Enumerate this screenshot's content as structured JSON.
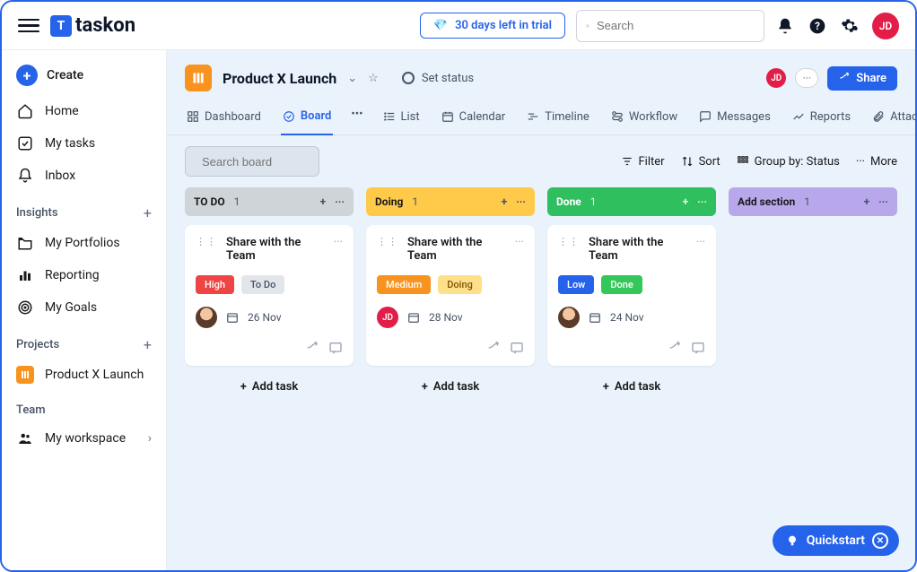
{
  "brand": "taskon",
  "trial_label": "30 days left in trial",
  "search_placeholder": "Search",
  "user_initials": "JD",
  "sidebar": {
    "create": "Create",
    "items": [
      {
        "id": "home",
        "label": "Home"
      },
      {
        "id": "mytasks",
        "label": "My tasks"
      },
      {
        "id": "inbox",
        "label": "Inbox"
      }
    ],
    "insights_label": "Insights",
    "insights": [
      {
        "id": "portfolios",
        "label": "My Portfolios"
      },
      {
        "id": "reporting",
        "label": "Reporting"
      },
      {
        "id": "goals",
        "label": "My Goals"
      }
    ],
    "projects_label": "Projects",
    "projects": [
      {
        "id": "productx",
        "label": "Product X Launch"
      }
    ],
    "team_label": "Team",
    "team": [
      {
        "id": "workspace",
        "label": "My workspace"
      }
    ]
  },
  "project": {
    "title": "Product X Launch",
    "set_status": "Set status",
    "share": "Share"
  },
  "tabs": [
    {
      "id": "dashboard",
      "label": "Dashboard"
    },
    {
      "id": "board",
      "label": "Board"
    },
    {
      "id": "list",
      "label": "List"
    },
    {
      "id": "calendar",
      "label": "Calendar"
    },
    {
      "id": "timeline",
      "label": "Timeline"
    },
    {
      "id": "workflow",
      "label": "Workflow"
    },
    {
      "id": "messages",
      "label": "Messages"
    },
    {
      "id": "reports",
      "label": "Reports"
    },
    {
      "id": "attachments",
      "label": "Attachments"
    }
  ],
  "board_search_placeholder": "Search board",
  "toolbar": {
    "filter": "Filter",
    "sort": "Sort",
    "groupby": "Group by: Status",
    "more": "More"
  },
  "add_task_label": "Add task",
  "columns": [
    {
      "id": "todo",
      "label": "TO DO",
      "count": 1,
      "color": "col-todo",
      "cards": [
        {
          "title": "Share with the Team",
          "tags": [
            {
              "label": "High",
              "cls": "tag-high"
            },
            {
              "label": "To Do",
              "cls": "tag-todo"
            }
          ],
          "assignee_type": "photo",
          "date": "26 Nov"
        }
      ]
    },
    {
      "id": "doing",
      "label": "Doing",
      "count": 1,
      "color": "col-doing",
      "cards": [
        {
          "title": "Share with the Team",
          "tags": [
            {
              "label": "Medium",
              "cls": "tag-med"
            },
            {
              "label": "Doing",
              "cls": "tag-doing"
            }
          ],
          "assignee_type": "jd",
          "date": "28 Nov"
        }
      ]
    },
    {
      "id": "done",
      "label": "Done",
      "count": 1,
      "color": "col-done",
      "cards": [
        {
          "title": "Share with the Team",
          "tags": [
            {
              "label": "Low",
              "cls": "tag-low"
            },
            {
              "label": "Done",
              "cls": "tag-done"
            }
          ],
          "assignee_type": "photo",
          "date": "24 Nov"
        }
      ]
    },
    {
      "id": "addsection",
      "label": "Add section",
      "count": 1,
      "color": "col-add",
      "cards": []
    }
  ],
  "quickstart": "Quickstart"
}
